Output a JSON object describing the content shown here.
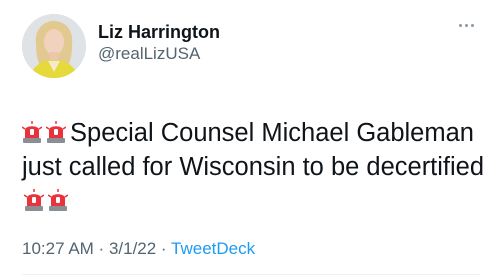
{
  "user": {
    "display_name": "Liz Harrington",
    "handle": "@realLizUSA"
  },
  "tweet": {
    "text_part1": "Special Counsel Michael Gableman just called for Wisconsin to be decertified",
    "emoji_name": "police-car-light"
  },
  "meta": {
    "time": "10:27 AM",
    "separator1": " · ",
    "date": "3/1/22",
    "separator2": " · ",
    "source": "TweetDeck"
  },
  "icons": {
    "more": "more-options-icon",
    "emoji": "police-car-light-icon"
  }
}
